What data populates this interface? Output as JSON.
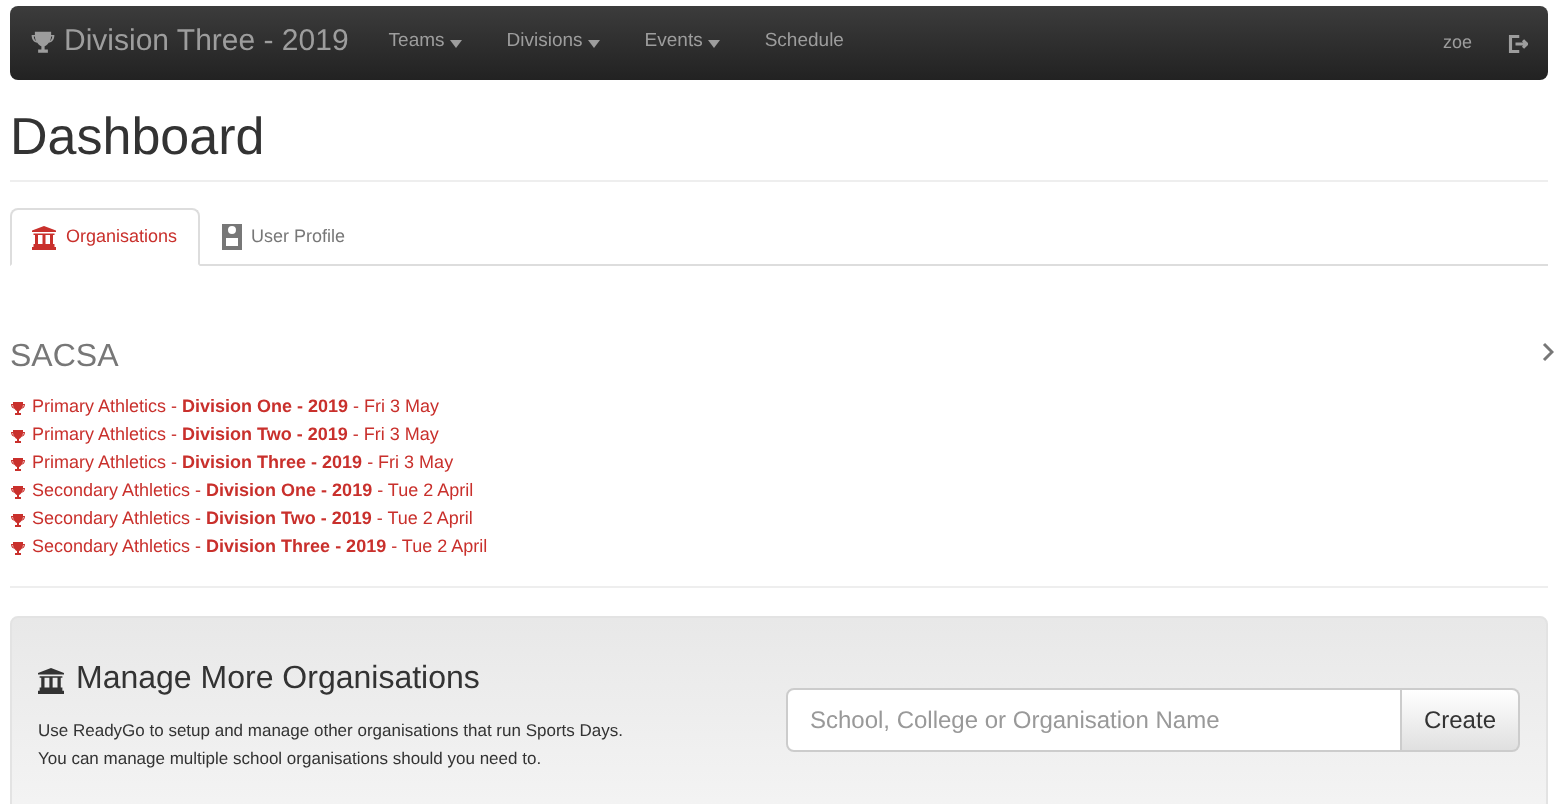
{
  "navbar": {
    "brand": "Division Three - 2019",
    "menus": [
      {
        "label": "Teams",
        "dropdown": true
      },
      {
        "label": "Divisions",
        "dropdown": true
      },
      {
        "label": "Events",
        "dropdown": true
      },
      {
        "label": "Schedule",
        "dropdown": false
      }
    ],
    "user": "zoe"
  },
  "page_title": "Dashboard",
  "tabs": [
    {
      "label": "Organisations",
      "selected": true
    },
    {
      "label": "User Profile",
      "selected": false
    }
  ],
  "organisation": {
    "name": "SACSA",
    "events": [
      {
        "text": "Primary Athletics - **Division One - 2019** - Fri 3 May"
      },
      {
        "text": "Primary Athletics - **Division Two - 2019** - Fri 3 May"
      },
      {
        "text": "Primary Athletics - **Division Three - 2019** - Fri 3 May"
      },
      {
        "text": "Secondary Athletics - **Division One - 2019** - Tue 2 April"
      },
      {
        "text": "Secondary Athletics - **Division Two - 2019** - Tue 2 April"
      },
      {
        "text": "Secondary Athletics - **Division Three - 2019** - Tue 2 April"
      }
    ]
  },
  "manage": {
    "title": "Manage More Organisations",
    "lines": [
      "Use ReadyGo to setup and manage other organisations that run Sports Days.",
      "You can manage multiple school organisations should you need to."
    ],
    "search": {
      "placeholder": "School, College or Organisation Name"
    },
    "button": "Create"
  }
}
